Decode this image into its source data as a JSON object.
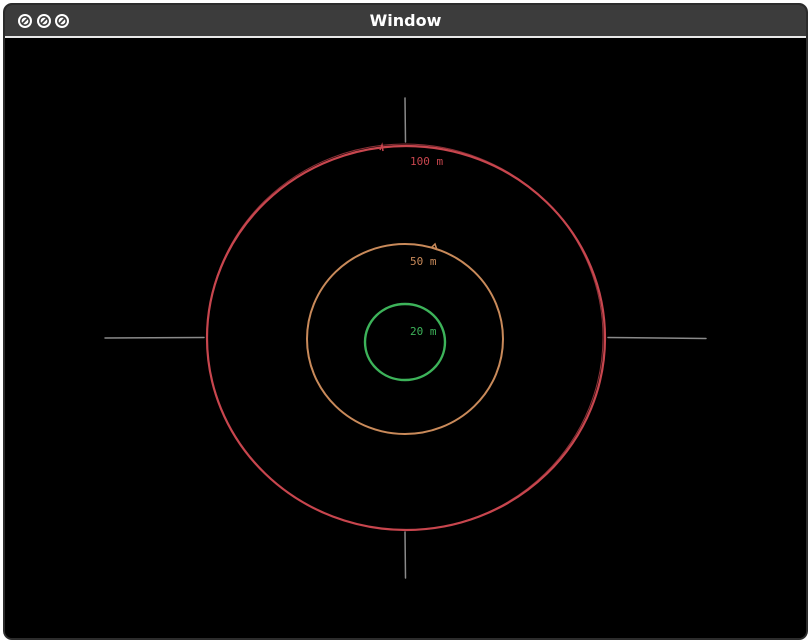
{
  "window": {
    "title": "Window",
    "controls": [
      {
        "name": "close-button",
        "icon": "slash-circle-icon"
      },
      {
        "name": "minimize-button",
        "icon": "slash-circle-icon"
      },
      {
        "name": "zoom-button",
        "icon": "slash-circle-icon"
      }
    ]
  },
  "rings": [
    {
      "label": "100 m",
      "color": "#c8464e"
    },
    {
      "label": "50 m",
      "color": "#c98a5a"
    },
    {
      "label": "20 m",
      "color": "#3db35a"
    }
  ],
  "colors": {
    "background": "#000000",
    "crosshair": "#8a8a8a",
    "titlebar": "#3c3c3c"
  }
}
